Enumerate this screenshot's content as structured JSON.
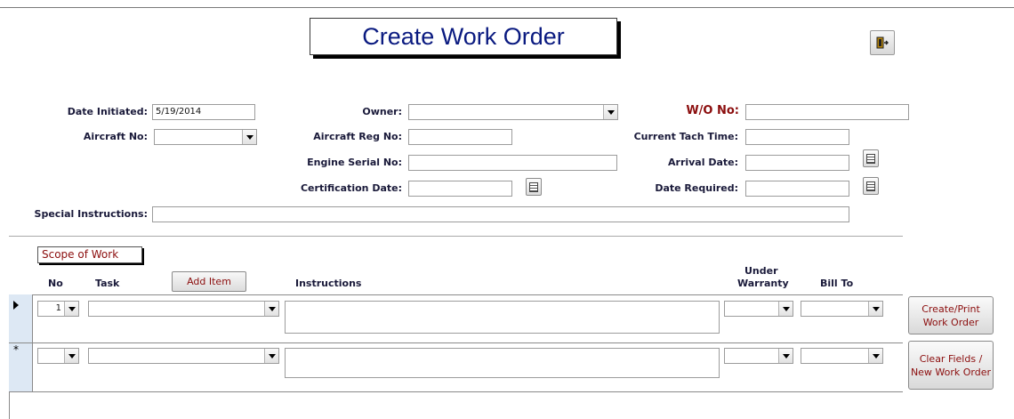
{
  "header": {
    "title": "Create Work Order",
    "exit_icon": "exit-door-icon"
  },
  "form": {
    "date_initiated": {
      "label": "Date Initiated:",
      "value": "5/19/2014"
    },
    "owner": {
      "label": "Owner:",
      "value": ""
    },
    "wo_no": {
      "label": "W/O No:",
      "value": ""
    },
    "aircraft_no": {
      "label": "Aircraft No:",
      "value": ""
    },
    "aircraft_reg_no": {
      "label": "Aircraft Reg No:",
      "value": ""
    },
    "current_tach_time": {
      "label": "Current Tach Time:",
      "value": ""
    },
    "engine_serial_no": {
      "label": "Engine Serial No:",
      "value": ""
    },
    "arrival_date": {
      "label": "Arrival Date:",
      "value": ""
    },
    "certification_date": {
      "label": "Certification Date:",
      "value": ""
    },
    "date_required": {
      "label": "Date Required:",
      "value": ""
    },
    "special_instructions": {
      "label": "Special Instructions:",
      "value": ""
    }
  },
  "scope": {
    "title": "Scope of Work",
    "add_item_label": "Add Item",
    "columns": {
      "no": "No",
      "task": "Task",
      "instructions": "Instructions",
      "under_warranty_1": "Under",
      "under_warranty_2": "Warranty",
      "bill_to": "Bill To"
    },
    "rows": [
      {
        "no": "1",
        "task": "",
        "instructions": "",
        "under_warranty": "",
        "bill_to": ""
      },
      {
        "no": "",
        "task": "",
        "instructions": "",
        "under_warranty": "",
        "bill_to": "",
        "new_record_marker": "*"
      }
    ]
  },
  "buttons": {
    "create_print_1": "Create/Print",
    "create_print_2": "Work Order",
    "clear_1": "Clear Fields /",
    "clear_2": "New Work Order"
  },
  "colors": {
    "title_text": "#0a1a80",
    "accent_red": "#8b0d0d",
    "selector_bg": "#dde8f4"
  }
}
